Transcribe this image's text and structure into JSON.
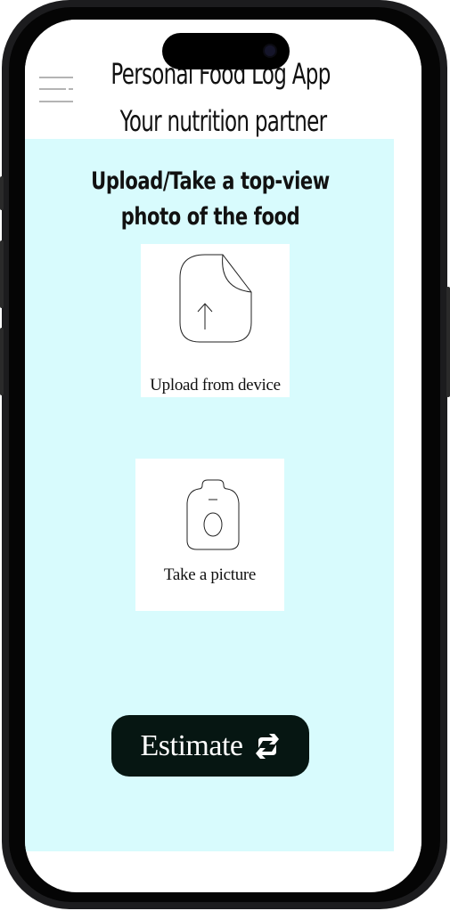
{
  "app": {
    "title_line1": "Personal Food Log App",
    "title_line2": "Your nutrition partner"
  },
  "menu": {
    "icon": "hamburger-menu-icon"
  },
  "main": {
    "prompt": "Upload/Take a top-view photo of the food",
    "upload_card": {
      "label": "Upload from device",
      "icon": "file-upload-icon"
    },
    "camera_card": {
      "label": "Take a picture",
      "icon": "camera-icon"
    },
    "estimate_button": {
      "label": "Estimate",
      "icon": "refresh-icon"
    }
  },
  "colors": {
    "content_bg": "#d8fbfd",
    "button_bg": "#061612",
    "card_bg": "#ffffff"
  }
}
